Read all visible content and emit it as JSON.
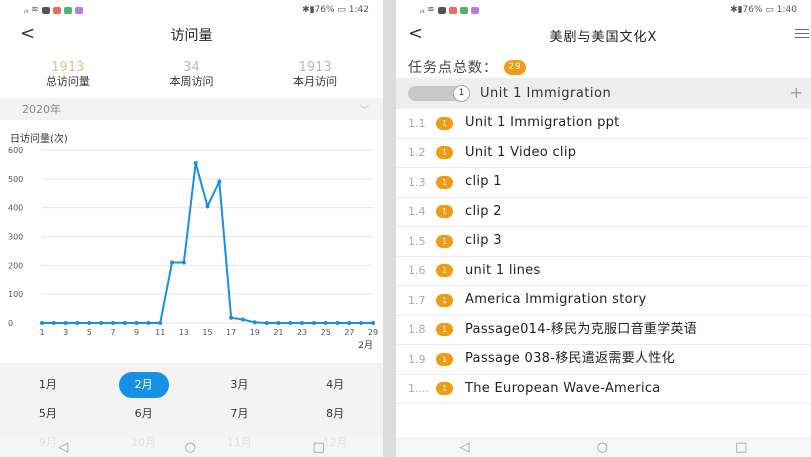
{
  "left": {
    "status": {
      "right": "✱▮76% ▭ 1:42"
    },
    "nav": {
      "back": "<",
      "title": "访问量"
    },
    "stats": [
      {
        "value": "1913",
        "label": "总访问量"
      },
      {
        "value": "34",
        "label": "本周访问"
      },
      {
        "value": "1913",
        "label": "本月访问"
      }
    ],
    "year": "2020年",
    "ylabel": "日访问量(次)",
    "months": [
      "1月",
      "2月",
      "3月",
      "4月",
      "5月",
      "6月",
      "7月",
      "8月",
      "9月",
      "10月",
      "11月",
      "12月"
    ],
    "selected_month": "2月",
    "softnav": [
      "◁",
      "○",
      "□"
    ],
    "colors": {
      "line": "#1a8fde",
      "selected": "#1591e8",
      "stat_total": "#e4c08d"
    }
  },
  "chart_data": {
    "type": "line",
    "xlabel": "2月",
    "ylabel": "日访问量(次)",
    "ylim": [
      0,
      600
    ],
    "yticks": [
      0,
      100,
      200,
      300,
      400,
      500,
      600
    ],
    "xticks": [
      1,
      3,
      5,
      7,
      9,
      11,
      13,
      15,
      17,
      19,
      21,
      23,
      25,
      27,
      29
    ],
    "series": [
      {
        "x": [
          1,
          2,
          3,
          4,
          5,
          6,
          7,
          8,
          9,
          10,
          11,
          12,
          13,
          14,
          15,
          16,
          17,
          18,
          19,
          20,
          21,
          22,
          23,
          24,
          25,
          26,
          27,
          28,
          29
        ],
        "values": [
          0,
          0,
          0,
          0,
          0,
          0,
          0,
          0,
          0,
          0,
          0,
          210,
          210,
          555,
          405,
          490,
          18,
          12,
          2,
          0,
          0,
          0,
          0,
          0,
          0,
          0,
          0,
          0,
          0
        ]
      }
    ]
  },
  "right": {
    "status": {
      "right": "✱▮76% ▭ 1:40"
    },
    "nav": {
      "back": "<",
      "title": "美剧与美国文化X"
    },
    "task_total_label": "任务点总数：",
    "task_total": "29",
    "unit": {
      "number": "1",
      "title": "Unit 1  Immigration",
      "plus": "+"
    },
    "tasks": [
      {
        "num": "1.1",
        "badge": "1",
        "title": "Unit 1 Immigration  ppt"
      },
      {
        "num": "1.2",
        "badge": "1",
        "title": "Unit 1 Video clip"
      },
      {
        "num": "1.3",
        "badge": "1",
        "title": "clip 1"
      },
      {
        "num": "1.4",
        "badge": "1",
        "title": "clip 2"
      },
      {
        "num": "1.5",
        "badge": "1",
        "title": "clip 3"
      },
      {
        "num": "1.6",
        "badge": "1",
        "title": "unit 1 lines"
      },
      {
        "num": "1.7",
        "badge": "1",
        "title": "America Immigration story"
      },
      {
        "num": "1.8",
        "badge": "1",
        "title": "Passage014-移民为克服口音重学英语"
      },
      {
        "num": "1.9",
        "badge": "1",
        "title": "Passage 038-移民遣返需要人性化"
      },
      {
        "num": "1....",
        "badge": "1",
        "title": "The European Wave-America"
      }
    ],
    "softnav": [
      "◁",
      "○",
      "□"
    ],
    "colors": {
      "badge": "#f39a13"
    }
  }
}
